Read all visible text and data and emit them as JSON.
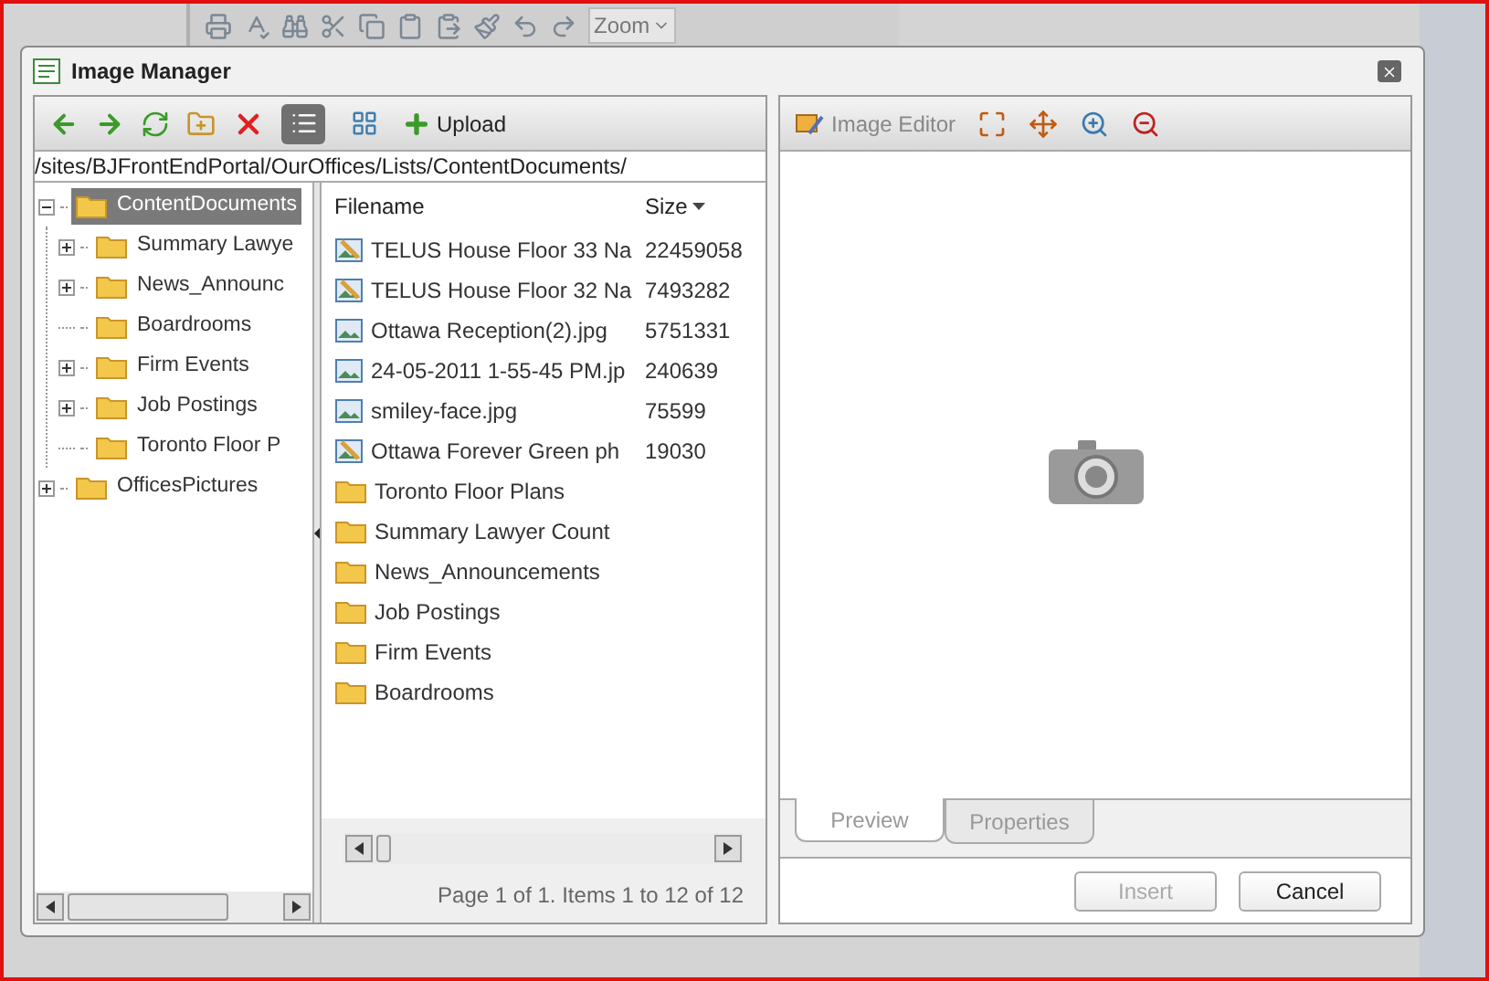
{
  "editor_toolbar": {
    "zoom": "Zoom"
  },
  "dialog": {
    "title": "Image Manager"
  },
  "toolbar": {
    "upload": "Upload",
    "view_buttons": [
      {
        "kind": "details",
        "selected": true
      },
      {
        "kind": "thumbnails",
        "selected": false
      }
    ]
  },
  "path": "/sites/BJFrontEndPortal/OurOffices/Lists/ContentDocuments/",
  "tree": [
    {
      "label": "ContentDocuments",
      "selected": true,
      "expanded": true,
      "expandable": true,
      "children": [
        {
          "label": "Summary Lawye",
          "selected": false,
          "expandable": true
        },
        {
          "label": "News_Announc",
          "selected": false,
          "expandable": true
        },
        {
          "label": "Boardrooms",
          "selected": false,
          "expandable": false
        },
        {
          "label": "Firm Events",
          "selected": false,
          "expandable": true
        },
        {
          "label": "Job Postings",
          "selected": false,
          "expandable": true
        },
        {
          "label": "Toronto Floor P",
          "selected": false,
          "expandable": false
        }
      ]
    },
    {
      "label": "OfficesPictures",
      "selected": false,
      "expanded": false,
      "expandable": true
    }
  ],
  "file_list": {
    "columns": [
      "Filename",
      "Size"
    ],
    "rows": [
      {
        "kind": "edited-image",
        "name": "TELUS House Floor 33 Na",
        "size": "22459058"
      },
      {
        "kind": "edited-image",
        "name": "TELUS House Floor 32 Na",
        "size": "7493282"
      },
      {
        "kind": "image",
        "name": "Ottawa Reception(2).jpg",
        "size": "5751331"
      },
      {
        "kind": "image",
        "name": "24-05-2011 1-55-45 PM.jp",
        "size": "240639"
      },
      {
        "kind": "image",
        "name": "smiley-face.jpg",
        "size": "75599"
      },
      {
        "kind": "edited-image",
        "name": "Ottawa Forever Green ph",
        "size": "19030"
      },
      {
        "kind": "folder",
        "name": "Toronto Floor Plans"
      },
      {
        "kind": "folder",
        "name": "Summary Lawyer Count"
      },
      {
        "kind": "folder",
        "name": "News_Announcements"
      },
      {
        "kind": "folder",
        "name": "Job Postings"
      },
      {
        "kind": "folder",
        "name": "Firm Events"
      },
      {
        "kind": "folder",
        "name": "Boardrooms"
      }
    ],
    "pager": "Page 1 of 1. Items 1 to 12 of 12"
  },
  "preview_toolbar": {
    "image_editor": "Image Editor"
  },
  "tabs": [
    {
      "label": "Preview",
      "selected": true
    },
    {
      "label": "Properties",
      "selected": false
    }
  ],
  "buttons": [
    {
      "label": "Insert",
      "disabled": true
    },
    {
      "label": "Cancel",
      "disabled": false
    }
  ]
}
